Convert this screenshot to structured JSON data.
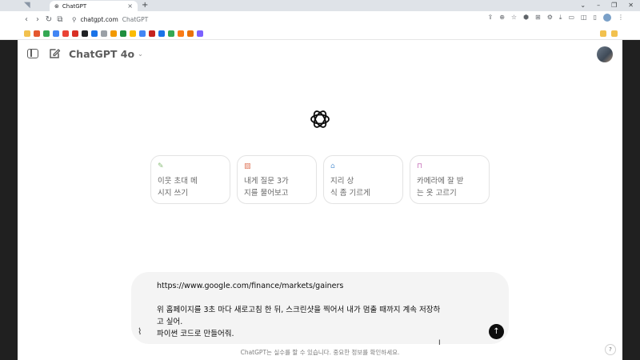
{
  "browser": {
    "tab_title": "ChatGPT",
    "tab_close": "×",
    "new_tab": "+",
    "url": "chatgpt.com",
    "page_title": "ChatGPT",
    "window_controls": [
      "⌄",
      "–",
      "❐",
      "✕"
    ]
  },
  "app": {
    "model_label": "ChatGPT 4o",
    "model_chevron": "⌄"
  },
  "suggestions": [
    {
      "icon": "pen-icon",
      "icon_color": "#8bbd7a",
      "text": "이웃 초대 메\n시지 쓰기"
    },
    {
      "icon": "image-icon",
      "icon_color": "#e07a5f",
      "text": "내게 질문 3가\n지를 물어보고"
    },
    {
      "icon": "graduation-cap-icon",
      "icon_color": "#6aa0d8",
      "text": "지리 상\n식 좀 기르게"
    },
    {
      "icon": "bag-icon",
      "icon_color": "#c46ab5",
      "text": "카메라에 잘 받\n는 옷 고르기"
    }
  ],
  "composer": {
    "text": "https://www.google.com/finance/markets/gainers\n\n위 홈페이지를 3초 마다 새로고침 한 뒤, 스크린샷을 찍어서 내가 멈출 때까지 계속 저장하\n고 싶어.\n파이썬 코드로 만들어줘."
  },
  "footer": {
    "disclaimer": "ChatGPT는 실수를 할 수 있습니다. 중요한 정보를 확인하세요.",
    "help": "?"
  },
  "colors": {
    "page_bg": "#ffffff",
    "composer_bg": "#f4f4f4",
    "send_bg": "#0d0d0d"
  }
}
